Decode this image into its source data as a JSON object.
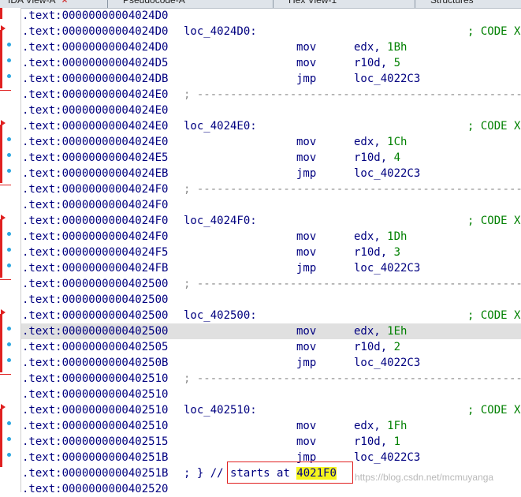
{
  "tabs": [
    {
      "label": "IDA View-A",
      "close": "×"
    },
    {
      "label": "Pseudocode-A"
    },
    {
      "label": "Hex View-1"
    },
    {
      "label": "Structures"
    }
  ],
  "rows": [
    {
      "addr": ".text:00000000004024D0"
    },
    {
      "addr": ".text:00000000004024D0",
      "label": "loc_4024D0:",
      "comment": "; CODE X"
    },
    {
      "addr": ".text:00000000004024D0",
      "mn": "mov",
      "op1": "edx, ",
      "num": "1Bh"
    },
    {
      "addr": ".text:00000000004024D5",
      "mn": "mov",
      "op1": "r10d, ",
      "num": "5"
    },
    {
      "addr": ".text:00000000004024DB",
      "mn": "jmp",
      "op1": "loc_4022C3",
      "num": ""
    },
    {
      "addr": ".text:00000000004024E0",
      "sep": true
    },
    {
      "addr": ".text:00000000004024E0"
    },
    {
      "addr": ".text:00000000004024E0",
      "label": "loc_4024E0:",
      "comment": "; CODE X"
    },
    {
      "addr": ".text:00000000004024E0",
      "mn": "mov",
      "op1": "edx, ",
      "num": "1Ch"
    },
    {
      "addr": ".text:00000000004024E5",
      "mn": "mov",
      "op1": "r10d, ",
      "num": "4"
    },
    {
      "addr": ".text:00000000004024EB",
      "mn": "jmp",
      "op1": "loc_4022C3",
      "num": ""
    },
    {
      "addr": ".text:00000000004024F0",
      "sep": true
    },
    {
      "addr": ".text:00000000004024F0"
    },
    {
      "addr": ".text:00000000004024F0",
      "label": "loc_4024F0:",
      "comment": "; CODE X"
    },
    {
      "addr": ".text:00000000004024F0",
      "mn": "mov",
      "op1": "edx, ",
      "num": "1Dh"
    },
    {
      "addr": ".text:00000000004024F5",
      "mn": "mov",
      "op1": "r10d, ",
      "num": "3"
    },
    {
      "addr": ".text:00000000004024FB",
      "mn": "jmp",
      "op1": "loc_4022C3",
      "num": ""
    },
    {
      "addr": ".text:0000000000402500",
      "sep": true
    },
    {
      "addr": ".text:0000000000402500"
    },
    {
      "addr": ".text:0000000000402500",
      "label": "loc_402500:",
      "comment": "; CODE X"
    },
    {
      "addr": ".text:0000000000402500",
      "mn": "mov",
      "op1": "edx, ",
      "num": "1Eh",
      "highlight": true
    },
    {
      "addr": ".text:0000000000402505",
      "mn": "mov",
      "op1": "r10d, ",
      "num": "2"
    },
    {
      "addr": ".text:000000000040250B",
      "mn": "jmp",
      "op1": "loc_4022C3",
      "num": ""
    },
    {
      "addr": ".text:0000000000402510",
      "sep": true
    },
    {
      "addr": ".text:0000000000402510"
    },
    {
      "addr": ".text:0000000000402510",
      "label": "loc_402510:",
      "comment": "; CODE X"
    },
    {
      "addr": ".text:0000000000402510",
      "mn": "mov",
      "op1": "edx, ",
      "num": "1Fh"
    },
    {
      "addr": ".text:0000000000402515",
      "mn": "mov",
      "op1": "r10d, ",
      "num": "1"
    },
    {
      "addr": ".text:000000000040251B",
      "mn": "jmp",
      "op1": "loc_4022C3",
      "num": ""
    },
    {
      "addr": ".text:000000000040251B",
      "endcomment": "; } // ",
      "starts": "starts at ",
      "target": "4021F0"
    },
    {
      "addr": ".text:0000000000402520"
    }
  ],
  "separator_text": "; ----------------------------------------------------------------------------",
  "watermark": "https://blog.csdn.net/mcmuyanga",
  "colors": {
    "address": "#000080",
    "number": "#008000",
    "highlight": "#f5f51c",
    "box": "#e02020"
  }
}
